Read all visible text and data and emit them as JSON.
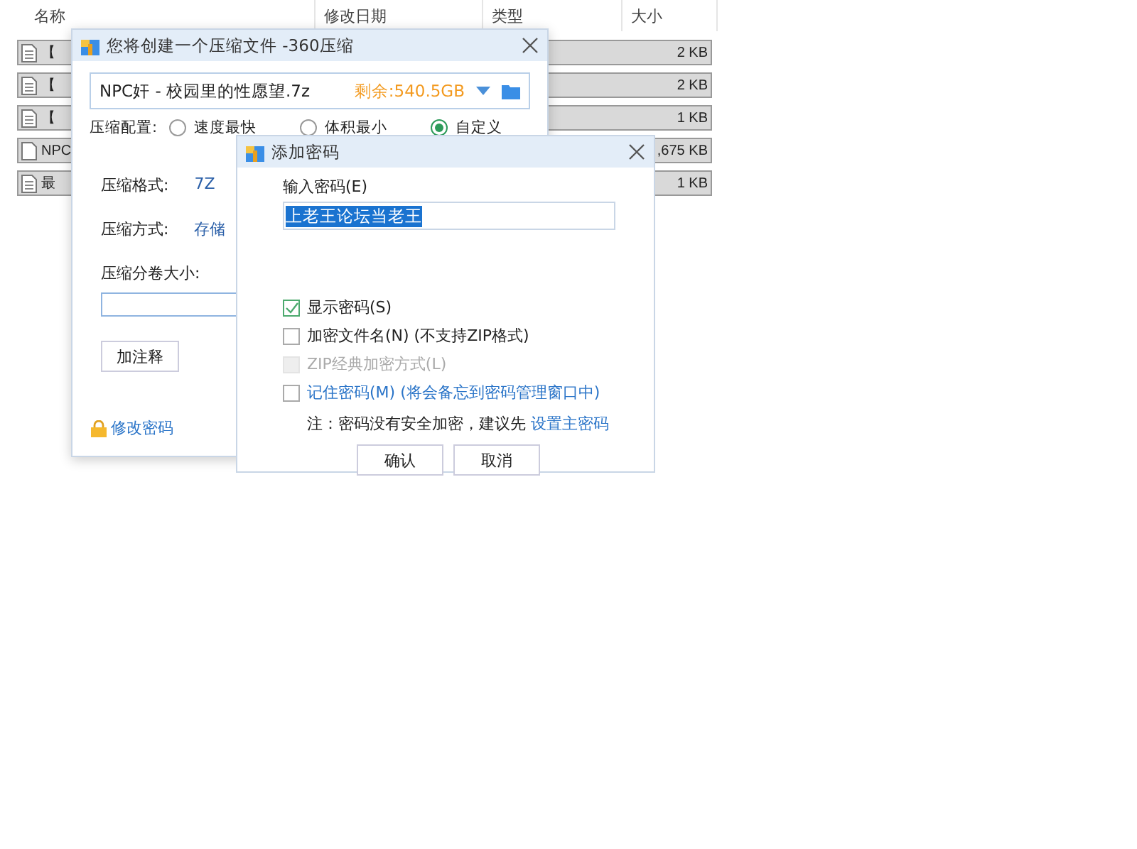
{
  "file_list": {
    "columns": [
      "名称",
      "修改日期",
      "类型",
      "大小"
    ],
    "rows": [
      {
        "name": "【",
        "size": "2 KB",
        "kind": "text",
        "selected": true
      },
      {
        "name": "【",
        "size": "2 KB",
        "kind": "text",
        "selected": true
      },
      {
        "name": "【",
        "size": "1 KB",
        "kind": "text",
        "selected": true
      },
      {
        "name": "NPC",
        "size": ",675 KB",
        "kind": "blank",
        "selected": true
      },
      {
        "name": "最",
        "size": "1 KB",
        "kind": "text",
        "selected": true
      }
    ]
  },
  "compress_dialog": {
    "title": "您将创建一个压缩文件 -360压缩",
    "path": "NPC奸 - 校园里的性愿望.7z",
    "free_space": "剩余:540.5GB",
    "config_label": "压缩配置:",
    "presets": [
      {
        "label": "速度最快",
        "selected": false
      },
      {
        "label": "体积最小",
        "selected": false
      },
      {
        "label": "自定义",
        "selected": true
      }
    ],
    "format_label": "压缩格式:",
    "format": "7Z",
    "method_label": "压缩方式:",
    "method": "存储",
    "split_label": "压缩分卷大小:",
    "comment_button": "加注释",
    "password_link": "修改密码"
  },
  "password_dialog": {
    "title": "添加密码",
    "input_label": "输入密码(E)",
    "password": "上老王论坛当老王",
    "options": [
      {
        "label": "显示密码(S)",
        "checked": true,
        "disabled": false,
        "link": false
      },
      {
        "label": "加密文件名(N) (不支持ZIP格式)",
        "checked": false,
        "disabled": false,
        "link": false
      },
      {
        "label": "ZIP经典加密方式(L)",
        "checked": false,
        "disabled": true,
        "link": false
      },
      {
        "label": "记住密码(M) (将会备忘到密码管理窗口中)",
        "checked": false,
        "disabled": false,
        "link": true
      }
    ],
    "note": "注：密码没有安全加密，建议先",
    "note_link": "设置主密码",
    "buttons": [
      "确认",
      "取消"
    ]
  }
}
